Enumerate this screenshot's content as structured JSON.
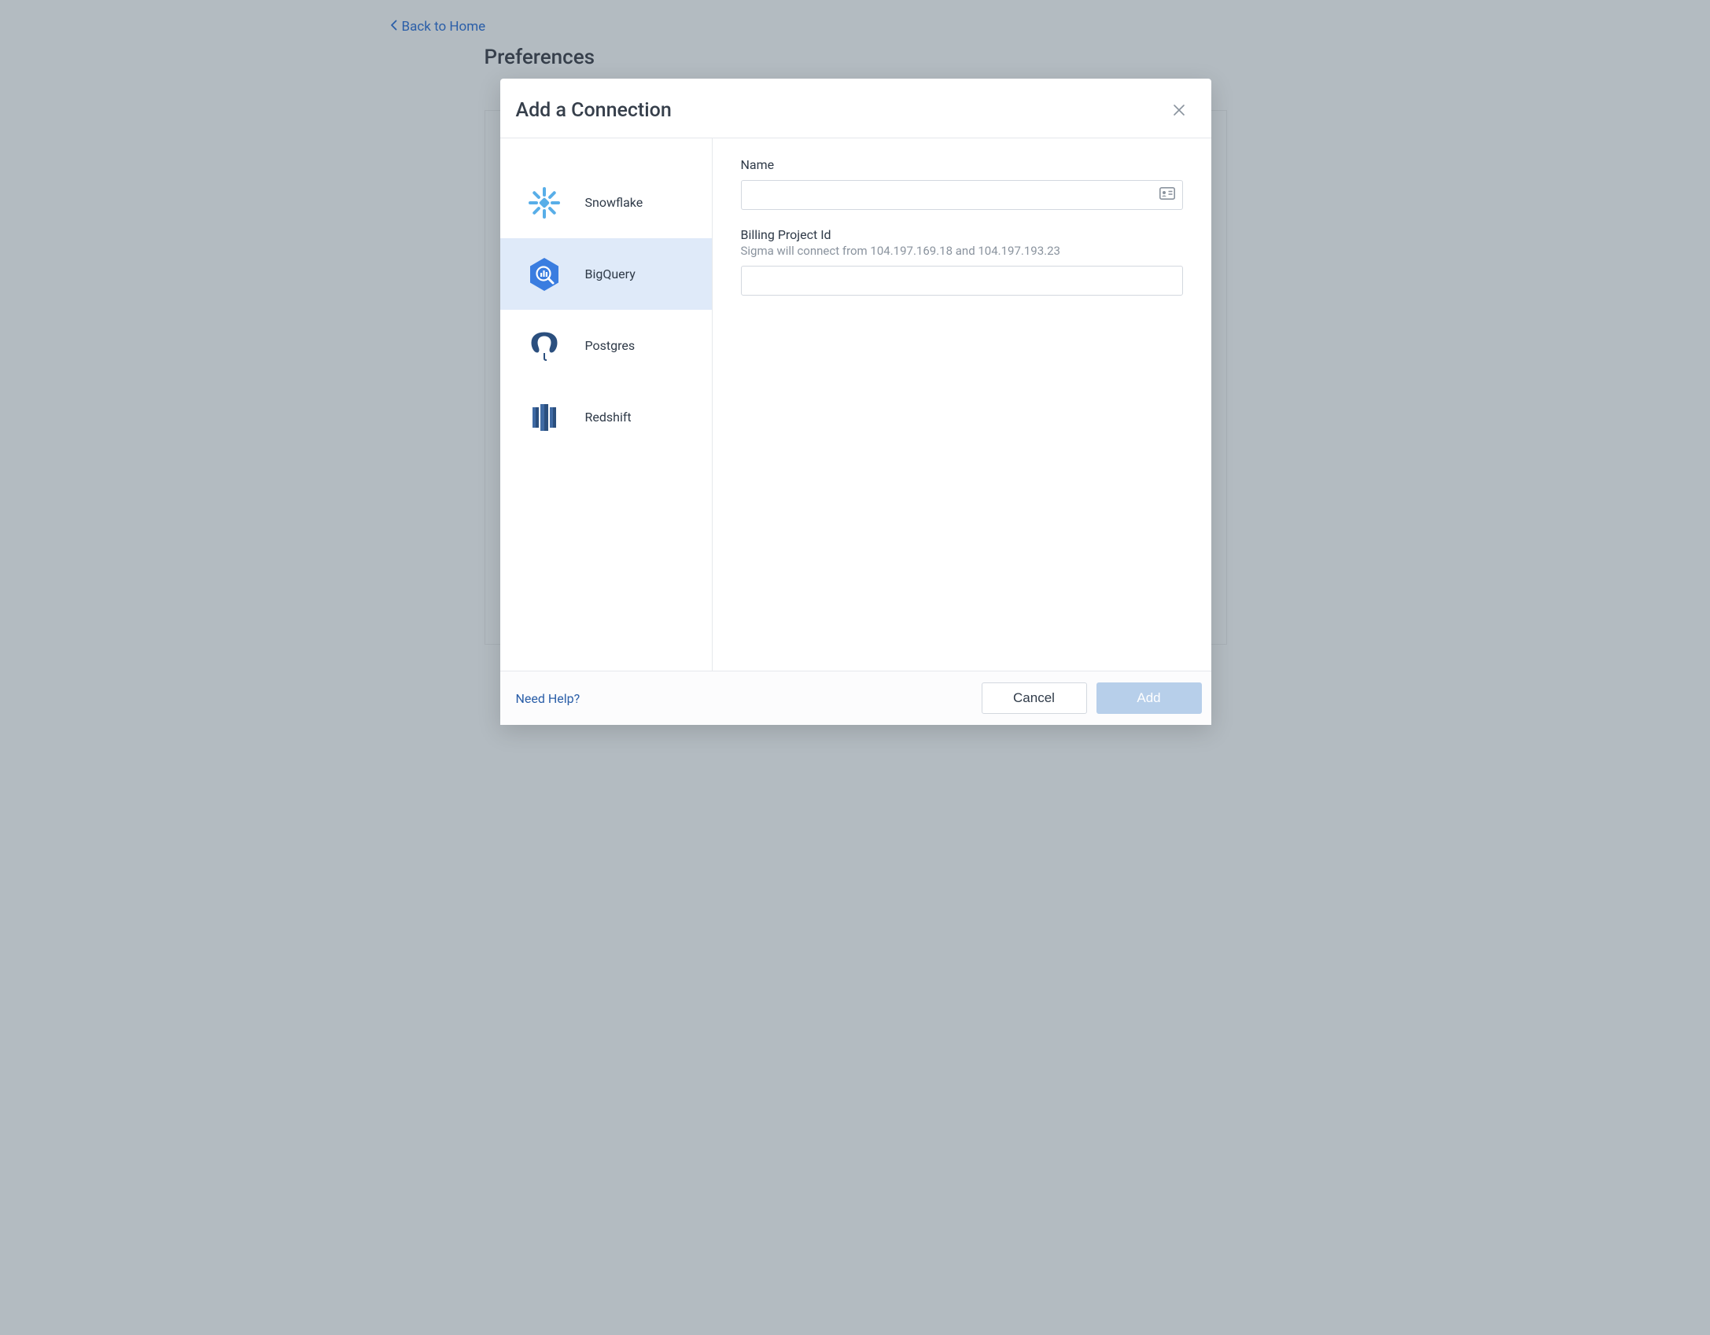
{
  "back_link": {
    "label": "Back to Home"
  },
  "page_title": "Preferences",
  "modal": {
    "title": "Add a Connection",
    "close_label": "Close",
    "sidebar": {
      "options": [
        {
          "id": "snowflake",
          "label": "Snowflake",
          "icon": "snowflake-icon",
          "selected": false
        },
        {
          "id": "bigquery",
          "label": "BigQuery",
          "icon": "bigquery-icon",
          "selected": true
        },
        {
          "id": "postgres",
          "label": "Postgres",
          "icon": "postgres-icon",
          "selected": false
        },
        {
          "id": "redshift",
          "label": "Redshift",
          "icon": "redshift-icon",
          "selected": false
        }
      ]
    },
    "form": {
      "name": {
        "label": "Name",
        "value": ""
      },
      "billing_project": {
        "label": "Billing Project Id",
        "hint": "Sigma will connect from 104.197.169.18 and 104.197.193.23",
        "value": ""
      }
    },
    "footer": {
      "help": "Need Help?",
      "cancel": "Cancel",
      "add": "Add"
    }
  }
}
